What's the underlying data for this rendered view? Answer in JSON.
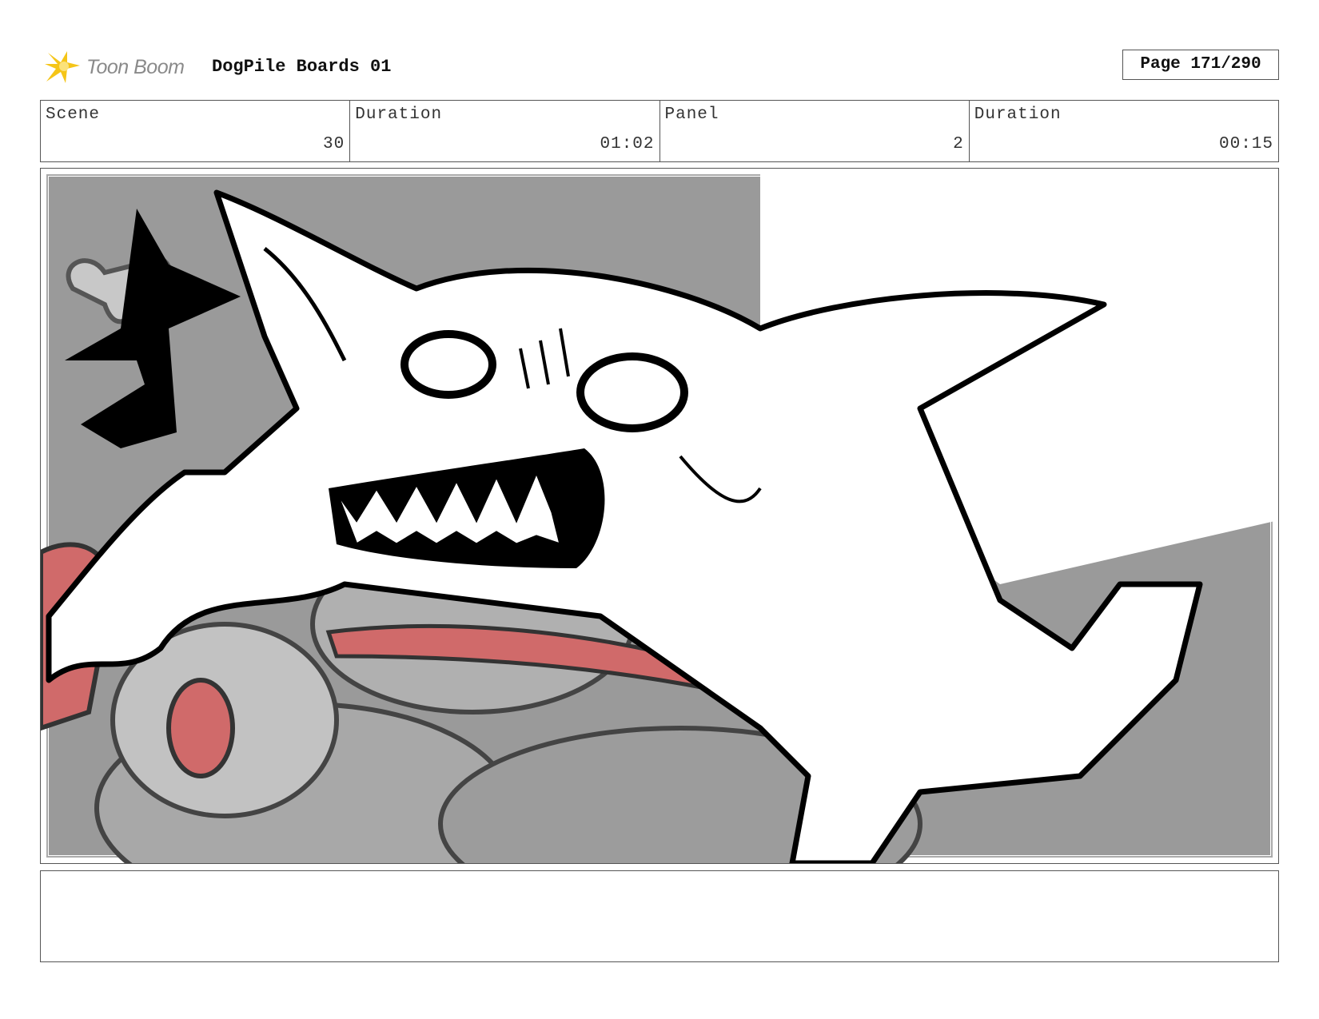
{
  "header": {
    "logo_text": "Toon Boom",
    "project_title": "DogPile Boards 01",
    "page_label": "Page 171/290"
  },
  "info": {
    "scene_label": "Scene",
    "scene_value": "30",
    "scene_duration_label": "Duration",
    "scene_duration_value": "01:02",
    "panel_label": "Panel",
    "panel_value": "2",
    "panel_duration_label": "Duration",
    "panel_duration_value": "00:15"
  },
  "notes": {
    "text": ""
  },
  "colors": {
    "logo_accent": "#f5c518",
    "background_gray": "#9a9a9a",
    "tongue_red": "#d06a6a"
  }
}
